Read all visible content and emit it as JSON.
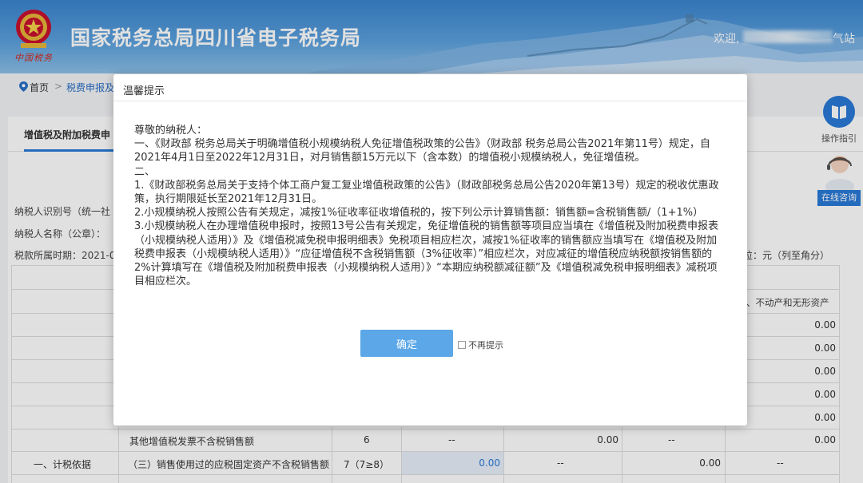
{
  "header": {
    "site_title": "国家税务总局四川省电子税务局",
    "emblem_caption": "中国税务",
    "welcome_prefix": "欢迎,",
    "welcome_suffix": "气站"
  },
  "breadcrumb": {
    "home": "首页",
    "separator": ">",
    "current": "税费申报及"
  },
  "tabs": [
    {
      "label": "增值税及附加税费申",
      "active": true
    }
  ],
  "form_info": {
    "taxpayer_id_label": "纳税人识别号（统一社",
    "taxpayer_name_label": "纳税人名称（公章）：",
    "period_label": "税款所属时期：2021-0",
    "unit_label": "位：元（列至角分）"
  },
  "table": {
    "header_text": "、不动产和无形资产",
    "right_col_values": [
      "0.00",
      "0.00",
      "0.00",
      "0.00",
      "0.00"
    ],
    "rows": [
      {
        "label": "其他增值税发票不含税销售额",
        "line": "6",
        "c1": "--",
        "c2": "0.00",
        "c3": "--",
        "c4": "0.00"
      },
      {
        "section": "一、计税依据",
        "label": "（三）销售使用过的应税固定资产不含税销售额",
        "line": "7（7≥8）",
        "c1": "0.00",
        "c2": "--",
        "c3": "0.00",
        "c4": "--"
      }
    ]
  },
  "side_tools": {
    "guide_label": "操作指引",
    "online_label": "在线咨询"
  },
  "modal": {
    "title": "温馨提示",
    "paragraphs": [
      "尊敬的纳税人：",
      "一、《财政部 税务总局关于明确增值税小规模纳税人免征增值税政策的公告》（财政部 税务总局公告2021年第11号）规定，自2021年4月1日至2022年12月31日，对月销售额15万元以下（含本数）的增值税小规模纳税人，免征增值税。",
      "二、",
      "1.《财政部税务总局关于支持个体工商户复工复业增值税政策的公告》（财政部税务总局公告2020年第13号）规定的税收优惠政策，执行期限延长至2021年12月31日。",
      "2.小规模纳税人按照公告有关规定，减按1%征收率征收增值税的，按下列公示计算销售额：销售额=含税销售额/（1+1%）",
      "3.小规模纳税人在办理增值税申报时，按照13号公告有关规定，免征增值税的销售额等项目应当填在《增值税及附加税费申报表（小规模纳税人适用）》及《增值税减免税申报明细表》免税项目相应栏次，减按1%征收率的销售额应当填写在《增值税及附加税费申报表（小规模纳税人适用）》“应征增值税不含税销售额（3%征收率）”相应栏次，对应减征的增值税应纳税额按销售额的2%计算填写在《增值税及附加税费申报表（小规模纳税人适用）》“本期应纳税额减征额”及《增值税减免税申报明细表》减税项目相应栏次。"
    ],
    "confirm_label": "确定",
    "no_show_label": "不再提示"
  }
}
